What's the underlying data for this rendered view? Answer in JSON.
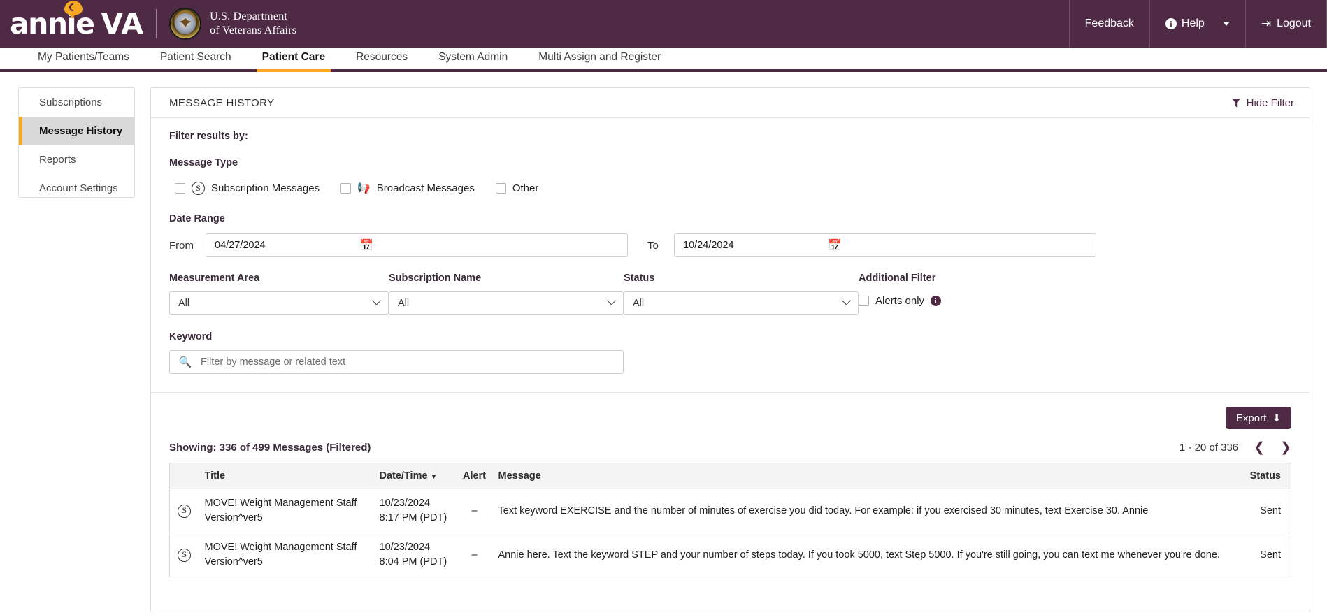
{
  "header": {
    "brand_annie": "annie",
    "brand_va": "VA",
    "va_line1": "U.S. Department",
    "va_line2": "of Veterans Affairs",
    "feedback": "Feedback",
    "help": "Help",
    "logout": "Logout",
    "brand_accent": "#f5a623",
    "bar_color": "#4e2a45"
  },
  "navtabs": [
    {
      "label": "My Patients/Teams",
      "active": false
    },
    {
      "label": "Patient Search",
      "active": false
    },
    {
      "label": "Patient Care",
      "active": true
    },
    {
      "label": "Resources",
      "active": false
    },
    {
      "label": "System Admin",
      "active": false
    },
    {
      "label": "Multi Assign and Register",
      "active": false
    }
  ],
  "sidebar": {
    "items": [
      {
        "label": "Subscriptions",
        "active": false
      },
      {
        "label": "Message History",
        "active": true
      },
      {
        "label": "Reports",
        "active": false
      },
      {
        "label": "Account Settings",
        "active": false
      }
    ]
  },
  "main": {
    "title": "MESSAGE HISTORY",
    "hide_filter": "Hide Filter"
  },
  "filters": {
    "heading": "Filter results by:",
    "message_type": {
      "label": "Message Type",
      "options": [
        {
          "label": "Subscription Messages",
          "icon": "s-circle-icon",
          "checked": false
        },
        {
          "label": "Broadcast Messages",
          "icon": "bullhorn-icon",
          "checked": false
        },
        {
          "label": "Other",
          "icon": "",
          "checked": false
        }
      ]
    },
    "date_range": {
      "label": "Date Range",
      "from_label": "From",
      "from_value": "04/27/2024",
      "to_label": "To",
      "to_value": "10/24/2024"
    },
    "measurement_area": {
      "label": "Measurement Area",
      "value": "All"
    },
    "subscription_name": {
      "label": "Subscription Name",
      "value": "All"
    },
    "status": {
      "label": "Status",
      "value": "All"
    },
    "additional_filter": {
      "label": "Additional Filter",
      "alerts_only": "Alerts only",
      "checked": false
    },
    "keyword": {
      "label": "Keyword",
      "value": "",
      "placeholder": "Filter by message or related text"
    }
  },
  "results": {
    "export_label": "Export",
    "showing": "Showing: 336 of 499 Messages (Filtered)",
    "pagination": "1 - 20 of 336",
    "columns": [
      "Title",
      "Date/Time",
      "Alert",
      "Message",
      "Status"
    ],
    "sorted_column": "Date/Time",
    "rows": [
      {
        "icon": "s-circle-icon",
        "title": "MOVE! Weight Management Staff Version^ver5",
        "date": "10/23/2024",
        "time": "8:17 PM (PDT)",
        "alert": "–",
        "message": "Text keyword EXERCISE and the number of minutes of exercise you did today. For example: if you exercised 30 minutes, text Exercise 30. Annie",
        "status": "Sent"
      },
      {
        "icon": "s-circle-icon",
        "title": "MOVE! Weight Management Staff Version^ver5",
        "date": "10/23/2024",
        "time": "8:04 PM (PDT)",
        "alert": "–",
        "message": "Annie here. Text the keyword STEP and your number of steps today. If you took 5000, text Step 5000. If you're still going, you can text me whenever you're done.",
        "status": "Sent"
      }
    ]
  }
}
